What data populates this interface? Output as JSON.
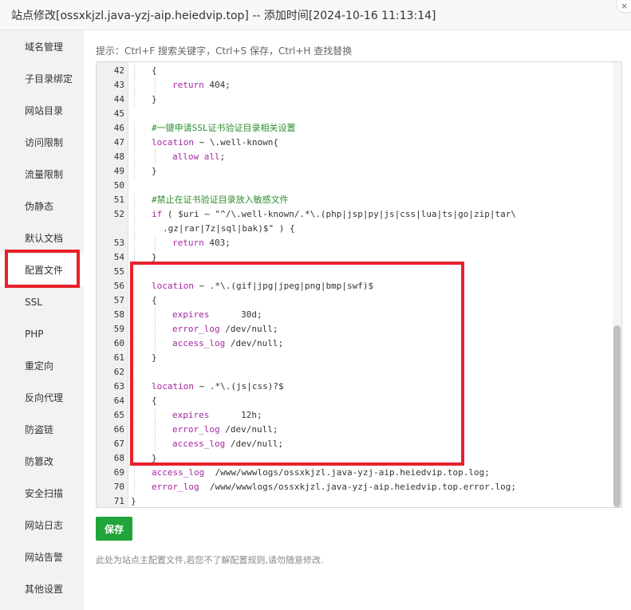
{
  "window": {
    "title": "站点修改[ossxkjzl.java-yzj-aip.heiedvip.top] -- 添加时间[2024-10-16 11:13:14]",
    "close_label": "×"
  },
  "sidebar": {
    "items": [
      {
        "label": "域名管理"
      },
      {
        "label": "子目录绑定"
      },
      {
        "label": "网站目录"
      },
      {
        "label": "访问限制"
      },
      {
        "label": "流量限制"
      },
      {
        "label": "伪静态"
      },
      {
        "label": "默认文档"
      },
      {
        "label": "配置文件",
        "active": true
      },
      {
        "label": "SSL"
      },
      {
        "label": "PHP"
      },
      {
        "label": "重定向"
      },
      {
        "label": "反向代理"
      },
      {
        "label": "防盗链"
      },
      {
        "label": "防篡改"
      },
      {
        "label": "安全扫描"
      },
      {
        "label": "网站日志"
      },
      {
        "label": "网站告警"
      },
      {
        "label": "其他设置"
      }
    ]
  },
  "editor": {
    "hint": "提示：Ctrl+F 搜索关键字，Ctrl+S 保存，Ctrl+H 查找替换",
    "lines": [
      {
        "n": "42",
        "text": "{",
        "indent": 1
      },
      {
        "n": "43",
        "text": "return 404;",
        "indent": 2
      },
      {
        "n": "44",
        "text": "}",
        "indent": 1
      },
      {
        "n": "45",
        "text": "",
        "indent": 0
      },
      {
        "n": "46",
        "text": "#一键申请SSL证书验证目录相关设置",
        "indent": 1
      },
      {
        "n": "47",
        "text": "location ~ \\.well-known{",
        "indent": 1
      },
      {
        "n": "48",
        "text": "allow all;",
        "indent": 2
      },
      {
        "n": "49",
        "text": "}",
        "indent": 1
      },
      {
        "n": "50",
        "text": "",
        "indent": 0
      },
      {
        "n": "51",
        "text": "#禁止在证书验证目录放入敏感文件",
        "indent": 1
      },
      {
        "n": "52",
        "text": "if ( $uri ~ \"^/\\.well-known/.*\\.(php|jsp|py|js|css|lua|ts|go|zip|tar\\",
        "indent": 1
      },
      {
        "n": "",
        "text": ".gz|rar|7z|sql|bak)$\" ) {",
        "indent": 1,
        "wrap": true
      },
      {
        "n": "53",
        "text": "return 403;",
        "indent": 2
      },
      {
        "n": "54",
        "text": "}",
        "indent": 1
      },
      {
        "n": "55",
        "text": "",
        "indent": 0
      },
      {
        "n": "56",
        "text": "location ~ .*\\.(gif|jpg|jpeg|png|bmp|swf)$",
        "indent": 1
      },
      {
        "n": "57",
        "text": "{",
        "indent": 1
      },
      {
        "n": "58",
        "text": "expires      30d;",
        "indent": 2
      },
      {
        "n": "59",
        "text": "error_log /dev/null;",
        "indent": 2
      },
      {
        "n": "60",
        "text": "access_log /dev/null;",
        "indent": 2
      },
      {
        "n": "61",
        "text": "}",
        "indent": 1
      },
      {
        "n": "62",
        "text": "",
        "indent": 0
      },
      {
        "n": "63",
        "text": "location ~ .*\\.(js|css)?$",
        "indent": 1
      },
      {
        "n": "64",
        "text": "{",
        "indent": 1
      },
      {
        "n": "65",
        "text": "expires      12h;",
        "indent": 2
      },
      {
        "n": "66",
        "text": "error_log /dev/null;",
        "indent": 2
      },
      {
        "n": "67",
        "text": "access_log /dev/null;",
        "indent": 2
      },
      {
        "n": "68",
        "text": "}",
        "indent": 1
      },
      {
        "n": "69",
        "text": "access_log  /www/wwwlogs/ossxkjzl.java-yzj-aip.heiedvip.top.log;",
        "indent": 1
      },
      {
        "n": "70",
        "text": "error_log  /www/wwwlogs/ossxkjzl.java-yzj-aip.heiedvip.top.error.log;",
        "indent": 1
      },
      {
        "n": "71",
        "text": "}",
        "indent": 0
      }
    ]
  },
  "actions": {
    "save_label": "保存"
  },
  "footer": {
    "note": "此处为站点主配置文件,若您不了解配置规则,请勿随意修改."
  },
  "colors": {
    "accent": "#20a53a",
    "highlight": "#e8202c",
    "keyword": "#a626a4",
    "comment": "#2f8f2f"
  }
}
